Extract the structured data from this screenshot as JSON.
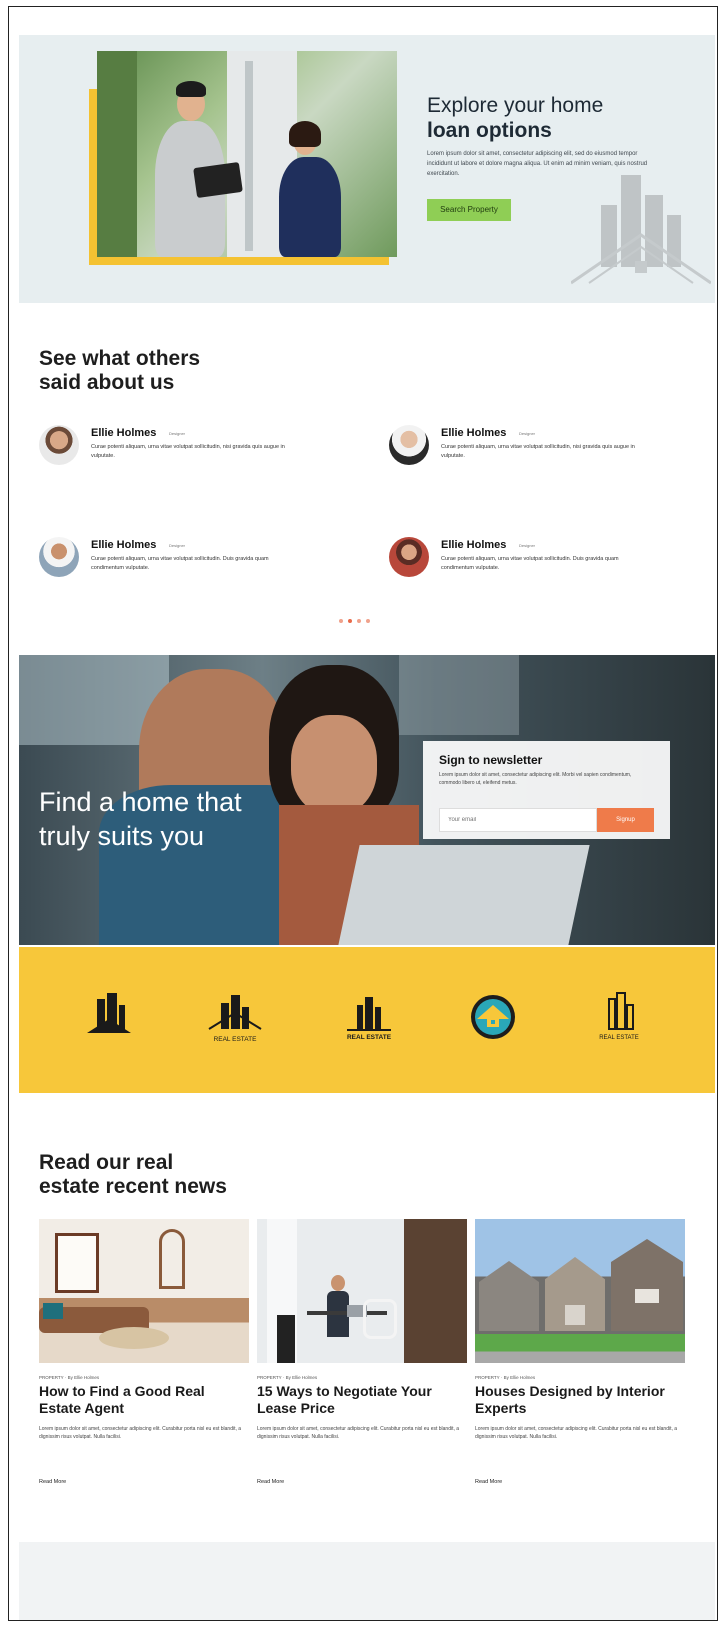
{
  "hero": {
    "title_line1": "Explore your home",
    "title_line2": "loan options",
    "text": "Lorem ipsum dolor sit amet, consectetur adipiscing elit, sed do eiusmod tempor incididunt ut labore et dolore magna aliqua. Ut enim ad minim veniam, quis nostrud exercitation.",
    "button_label": "Search Property"
  },
  "testimonials": {
    "heading_line1": "See what others",
    "heading_line2_plain": "said ",
    "heading_line2_bold": "about us",
    "items": [
      {
        "name": "Ellie Holmes",
        "role": "Designer",
        "text": "Curae potenti aliquam, urna vitae volutpat sollicitudin, nisi gravida quis augue in vulputate."
      },
      {
        "name": "Ellie Holmes",
        "role": "Designer",
        "text": "Curae potenti aliquam, urna vitae volutpat sollicitudin, nisi gravida quis augue in vulputate."
      },
      {
        "name": "Ellie Holmes",
        "role": "Designer",
        "text": "Curae potenti aliquam, urna vitae volutpat sollicitudin. Duis gravida quam condimentum vulputate."
      },
      {
        "name": "Ellie Holmes",
        "role": "Designer",
        "text": "Curae potenti aliquam, urna vitae volutpat sollicitudin. Duis gravida quam condimentum vulputate."
      }
    ]
  },
  "banner": {
    "title_line1": "Find a home that",
    "title_line2": "truly suits you",
    "newsletter_title": "Sign to newsletter",
    "newsletter_text": "Lorem ipsum dolor sit amet, consectetur adipiscing elit. Morbi vel sapien condimentum, commodo libero ut, eleifend metus.",
    "email_placeholder": "Your email",
    "button_label": "Signup"
  },
  "logos": [
    {
      "name": "REAL ESTATE"
    },
    {
      "name": "REAL ESTATE"
    },
    {
      "name": "REAL ESTATE"
    },
    {
      "name": ""
    },
    {
      "name": "REAL ESTATE"
    }
  ],
  "news": {
    "heading_line1": "Read our real",
    "heading_line2_plain": "estate ",
    "heading_line2_bold": "recent news",
    "posts": [
      {
        "meta": "PROPERTY · By Ellie Holmes",
        "title": "How to Find a Good Real Estate Agent",
        "text": "Lorem ipsum dolor sit amet, consectetur adipiscing elit. Curabitur porta nisl eu est blandit, a dignissim risus volutpat. Nulla facilisi.",
        "more": "Read More"
      },
      {
        "meta": "PROPERTY · By Ellie Holmes",
        "title": "15 Ways to Negotiate Your Lease Price",
        "text": "Lorem ipsum dolor sit amet, consectetur adipiscing elit. Curabitur porta nisl eu est blandit, a dignissim risus volutpat. Nulla facilisi.",
        "more": "Read More"
      },
      {
        "meta": "PROPERTY · By Ellie Holmes",
        "title": "Houses Designed by Interior Experts",
        "text": "Lorem ipsum dolor sit amet, consectetur adipiscing elit. Curabitur porta nisl eu est blandit, a dignissim risus volutpat. Nulla facilisi.",
        "more": "Read More"
      }
    ]
  },
  "colors": {
    "hero_bg": "#e7eef0",
    "accent_yellow": "#f7c73a",
    "button_green": "#8fce55",
    "button_orange": "#ef7b4a"
  }
}
